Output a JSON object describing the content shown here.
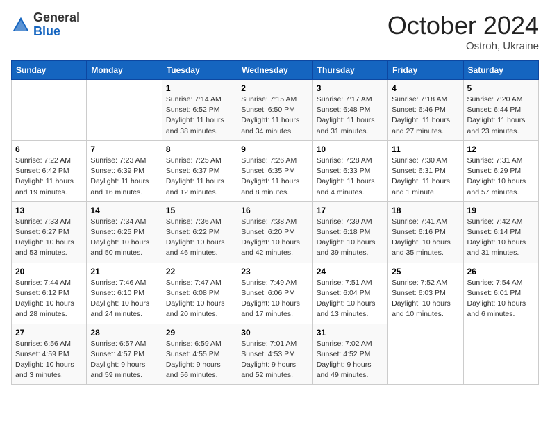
{
  "header": {
    "logo_general": "General",
    "logo_blue": "Blue",
    "month_title": "October 2024",
    "location": "Ostroh, Ukraine"
  },
  "weekdays": [
    "Sunday",
    "Monday",
    "Tuesday",
    "Wednesday",
    "Thursday",
    "Friday",
    "Saturday"
  ],
  "weeks": [
    [
      {
        "day": "",
        "sunrise": "",
        "sunset": "",
        "daylight": ""
      },
      {
        "day": "",
        "sunrise": "",
        "sunset": "",
        "daylight": ""
      },
      {
        "day": "1",
        "sunrise": "Sunrise: 7:14 AM",
        "sunset": "Sunset: 6:52 PM",
        "daylight": "Daylight: 11 hours and 38 minutes."
      },
      {
        "day": "2",
        "sunrise": "Sunrise: 7:15 AM",
        "sunset": "Sunset: 6:50 PM",
        "daylight": "Daylight: 11 hours and 34 minutes."
      },
      {
        "day": "3",
        "sunrise": "Sunrise: 7:17 AM",
        "sunset": "Sunset: 6:48 PM",
        "daylight": "Daylight: 11 hours and 31 minutes."
      },
      {
        "day": "4",
        "sunrise": "Sunrise: 7:18 AM",
        "sunset": "Sunset: 6:46 PM",
        "daylight": "Daylight: 11 hours and 27 minutes."
      },
      {
        "day": "5",
        "sunrise": "Sunrise: 7:20 AM",
        "sunset": "Sunset: 6:44 PM",
        "daylight": "Daylight: 11 hours and 23 minutes."
      }
    ],
    [
      {
        "day": "6",
        "sunrise": "Sunrise: 7:22 AM",
        "sunset": "Sunset: 6:42 PM",
        "daylight": "Daylight: 11 hours and 19 minutes."
      },
      {
        "day": "7",
        "sunrise": "Sunrise: 7:23 AM",
        "sunset": "Sunset: 6:39 PM",
        "daylight": "Daylight: 11 hours and 16 minutes."
      },
      {
        "day": "8",
        "sunrise": "Sunrise: 7:25 AM",
        "sunset": "Sunset: 6:37 PM",
        "daylight": "Daylight: 11 hours and 12 minutes."
      },
      {
        "day": "9",
        "sunrise": "Sunrise: 7:26 AM",
        "sunset": "Sunset: 6:35 PM",
        "daylight": "Daylight: 11 hours and 8 minutes."
      },
      {
        "day": "10",
        "sunrise": "Sunrise: 7:28 AM",
        "sunset": "Sunset: 6:33 PM",
        "daylight": "Daylight: 11 hours and 4 minutes."
      },
      {
        "day": "11",
        "sunrise": "Sunrise: 7:30 AM",
        "sunset": "Sunset: 6:31 PM",
        "daylight": "Daylight: 11 hours and 1 minute."
      },
      {
        "day": "12",
        "sunrise": "Sunrise: 7:31 AM",
        "sunset": "Sunset: 6:29 PM",
        "daylight": "Daylight: 10 hours and 57 minutes."
      }
    ],
    [
      {
        "day": "13",
        "sunrise": "Sunrise: 7:33 AM",
        "sunset": "Sunset: 6:27 PM",
        "daylight": "Daylight: 10 hours and 53 minutes."
      },
      {
        "day": "14",
        "sunrise": "Sunrise: 7:34 AM",
        "sunset": "Sunset: 6:25 PM",
        "daylight": "Daylight: 10 hours and 50 minutes."
      },
      {
        "day": "15",
        "sunrise": "Sunrise: 7:36 AM",
        "sunset": "Sunset: 6:22 PM",
        "daylight": "Daylight: 10 hours and 46 minutes."
      },
      {
        "day": "16",
        "sunrise": "Sunrise: 7:38 AM",
        "sunset": "Sunset: 6:20 PM",
        "daylight": "Daylight: 10 hours and 42 minutes."
      },
      {
        "day": "17",
        "sunrise": "Sunrise: 7:39 AM",
        "sunset": "Sunset: 6:18 PM",
        "daylight": "Daylight: 10 hours and 39 minutes."
      },
      {
        "day": "18",
        "sunrise": "Sunrise: 7:41 AM",
        "sunset": "Sunset: 6:16 PM",
        "daylight": "Daylight: 10 hours and 35 minutes."
      },
      {
        "day": "19",
        "sunrise": "Sunrise: 7:42 AM",
        "sunset": "Sunset: 6:14 PM",
        "daylight": "Daylight: 10 hours and 31 minutes."
      }
    ],
    [
      {
        "day": "20",
        "sunrise": "Sunrise: 7:44 AM",
        "sunset": "Sunset: 6:12 PM",
        "daylight": "Daylight: 10 hours and 28 minutes."
      },
      {
        "day": "21",
        "sunrise": "Sunrise: 7:46 AM",
        "sunset": "Sunset: 6:10 PM",
        "daylight": "Daylight: 10 hours and 24 minutes."
      },
      {
        "day": "22",
        "sunrise": "Sunrise: 7:47 AM",
        "sunset": "Sunset: 6:08 PM",
        "daylight": "Daylight: 10 hours and 20 minutes."
      },
      {
        "day": "23",
        "sunrise": "Sunrise: 7:49 AM",
        "sunset": "Sunset: 6:06 PM",
        "daylight": "Daylight: 10 hours and 17 minutes."
      },
      {
        "day": "24",
        "sunrise": "Sunrise: 7:51 AM",
        "sunset": "Sunset: 6:04 PM",
        "daylight": "Daylight: 10 hours and 13 minutes."
      },
      {
        "day": "25",
        "sunrise": "Sunrise: 7:52 AM",
        "sunset": "Sunset: 6:03 PM",
        "daylight": "Daylight: 10 hours and 10 minutes."
      },
      {
        "day": "26",
        "sunrise": "Sunrise: 7:54 AM",
        "sunset": "Sunset: 6:01 PM",
        "daylight": "Daylight: 10 hours and 6 minutes."
      }
    ],
    [
      {
        "day": "27",
        "sunrise": "Sunrise: 6:56 AM",
        "sunset": "Sunset: 4:59 PM",
        "daylight": "Daylight: 10 hours and 3 minutes."
      },
      {
        "day": "28",
        "sunrise": "Sunrise: 6:57 AM",
        "sunset": "Sunset: 4:57 PM",
        "daylight": "Daylight: 9 hours and 59 minutes."
      },
      {
        "day": "29",
        "sunrise": "Sunrise: 6:59 AM",
        "sunset": "Sunset: 4:55 PM",
        "daylight": "Daylight: 9 hours and 56 minutes."
      },
      {
        "day": "30",
        "sunrise": "Sunrise: 7:01 AM",
        "sunset": "Sunset: 4:53 PM",
        "daylight": "Daylight: 9 hours and 52 minutes."
      },
      {
        "day": "31",
        "sunrise": "Sunrise: 7:02 AM",
        "sunset": "Sunset: 4:52 PM",
        "daylight": "Daylight: 9 hours and 49 minutes."
      },
      {
        "day": "",
        "sunrise": "",
        "sunset": "",
        "daylight": ""
      },
      {
        "day": "",
        "sunrise": "",
        "sunset": "",
        "daylight": ""
      }
    ]
  ]
}
